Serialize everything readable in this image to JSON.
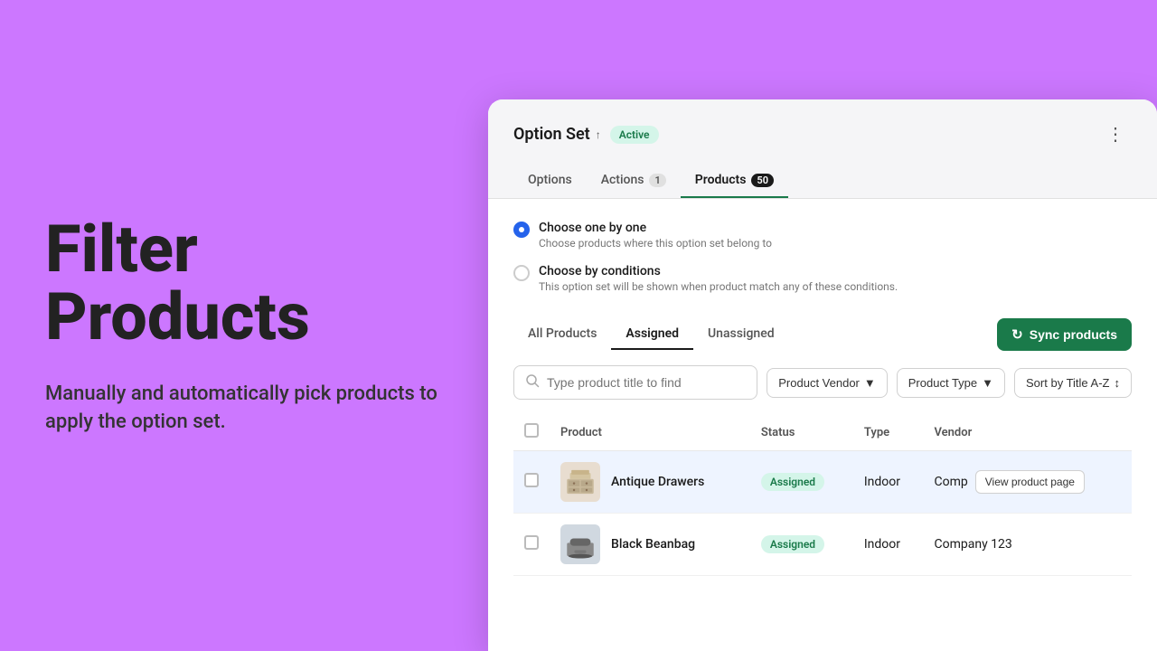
{
  "left": {
    "title_line1": "Filter",
    "title_line2": "Products",
    "subtitle": "Manually and automatically pick products to apply the option set."
  },
  "header": {
    "option_set_label": "Option Set",
    "chevron": "^",
    "badge_active": "Active",
    "more_icon": "•••"
  },
  "tabs": [
    {
      "id": "options",
      "label": "Options",
      "badge": null,
      "active": false
    },
    {
      "id": "actions",
      "label": "Actions",
      "badge": "1",
      "active": false
    },
    {
      "id": "products",
      "label": "Products",
      "badge": "50",
      "active": true
    }
  ],
  "radio_options": [
    {
      "id": "one-by-one",
      "label": "Choose one by one",
      "description": "Choose products where this option set belong to",
      "checked": true
    },
    {
      "id": "by-conditions",
      "label": "Choose by conditions",
      "description": "This option set will be shown when product match any of these conditions.",
      "checked": false
    }
  ],
  "sub_tabs": [
    {
      "id": "all-products",
      "label": "All Products",
      "active": false
    },
    {
      "id": "assigned",
      "label": "Assigned",
      "active": true
    },
    {
      "id": "unassigned",
      "label": "Unassigned",
      "active": false
    }
  ],
  "sync_button": "Sync products",
  "search": {
    "placeholder": "Type product title to find"
  },
  "filters": [
    {
      "id": "vendor",
      "label": "Product Vendor"
    },
    {
      "id": "type",
      "label": "Product Type"
    }
  ],
  "sort": {
    "label": "Sort by Title A-Z"
  },
  "table": {
    "columns": [
      "Product",
      "Status",
      "Type",
      "Vendor"
    ],
    "rows": [
      {
        "id": 1,
        "name": "Antique Drawers",
        "status": "Assigned",
        "type": "Indoor",
        "vendor": "Comp",
        "show_view_btn": true
      },
      {
        "id": 2,
        "name": "Black Beanbag",
        "status": "Assigned",
        "type": "Indoor",
        "vendor": "Company 123",
        "show_view_btn": false
      }
    ]
  },
  "colors": {
    "accent_green": "#1a7a4a",
    "badge_green_bg": "#d4f5e9",
    "purple_bg": "#cc77ff",
    "active_tab_underline": "#1a7a4a"
  }
}
